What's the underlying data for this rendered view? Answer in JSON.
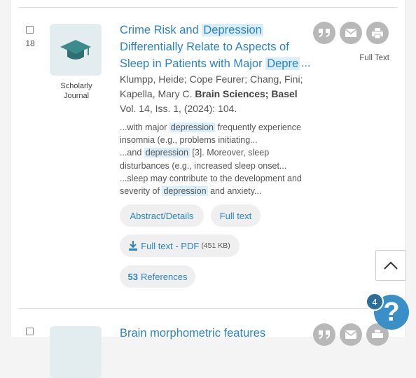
{
  "record1": {
    "number": "18",
    "type_label_line1": "Scholarly",
    "type_label_line2": "Journal",
    "title_part1": "Crime Risk and ",
    "title_highlight1": "Depression",
    "title_part2": " Differentially Relate to Aspects of Sleep in Patients with Major ",
    "title_highlight2": "Depre",
    "title_ellipsis": "...",
    "authors": "Klumpp, Heide; Cope Feurer; Chang, Fini; Kapella, Mary C.",
    "source": "Brain Sciences; Basel",
    "citation": "Vol. 14, Iss. 1,  (2024): 104.",
    "snippet1_pre": "...with major ",
    "snippet1_hl": "depression",
    "snippet1_post": " frequently experience insomnia (e.g., problems initiating...",
    "snippet2_pre": "...and ",
    "snippet2_hl": "depression",
    "snippet2_post": " [3]. Moreover, sleep disturbances (e.g., increased sleep onset...",
    "snippet3_pre": "...sleep may contribute to the development and severity of ",
    "snippet3_hl": "depression",
    "snippet3_post": " and anxiety...",
    "abstract_label": "Abstract/Details",
    "fulltext_label": "Full text",
    "pdf_label": "Full text - PDF",
    "pdf_size": "(451 KB)",
    "references_count": "53",
    "references_label": "References",
    "full_text_caption": "Full Text"
  },
  "record2": {
    "title_start": "Brain morphometric features"
  },
  "help": {
    "badge_count": "4",
    "icon": "?"
  },
  "icons": {
    "cite": "quote-icon",
    "email": "envelope-icon",
    "print": "printer-icon",
    "pdf": "pdf-icon",
    "scroll": "chevron-up-icon",
    "thumb": "graduation-cap-icon"
  },
  "colors": {
    "link": "#2a83c4",
    "highlight": "#d9eef8",
    "action_icon": "#b8b8b8",
    "help_button": "#3a8fc6"
  }
}
